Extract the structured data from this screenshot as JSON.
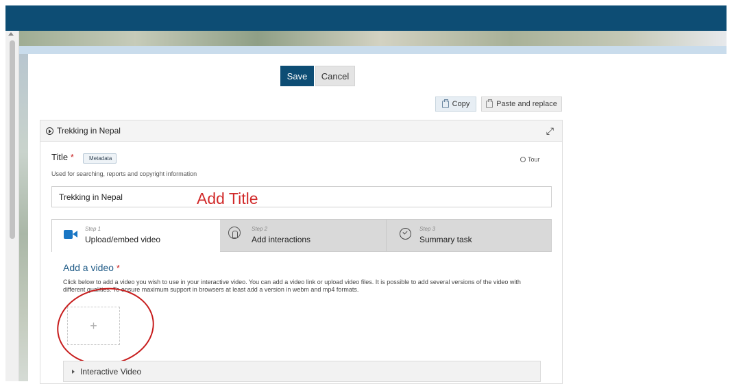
{
  "toolbar": {
    "save_label": "Save",
    "cancel_label": "Cancel",
    "copy_label": "Copy",
    "paste_label": "Paste and replace"
  },
  "editor": {
    "header_title": "Trekking in Nepal",
    "title_field": {
      "label": "Title",
      "required_mark": "*",
      "metadata_label": "Metadata",
      "description": "Used for searching, reports and copyright information",
      "value": "Trekking in Nepal"
    },
    "tour_label": "Tour",
    "annotation": "Add Title",
    "tabs": [
      {
        "step": "Step 1",
        "label": "Upload/embed video",
        "icon": "video-camera-icon",
        "active": true
      },
      {
        "step": "Step 2",
        "label": "Add interactions",
        "icon": "touch-icon",
        "active": false
      },
      {
        "step": "Step 3",
        "label": "Summary task",
        "icon": "check-circle-icon",
        "active": false
      }
    ],
    "section": {
      "title": "Add a video",
      "required_mark": "*",
      "description": "Click below to add a video you wish to use in your interactive video. You can add a video link or upload video files. It is possible to add several versions of the video with different qualities. To ensure maximum support in browsers at least add a version in webm and mp4 formats.",
      "add_symbol": "+"
    },
    "accordion_label": "Interactive Video"
  },
  "colors": {
    "topbar": "#0d4d74",
    "save_button": "#0d4d74",
    "annotation_red": "#d12a2a",
    "video_icon": "#1976c4"
  }
}
